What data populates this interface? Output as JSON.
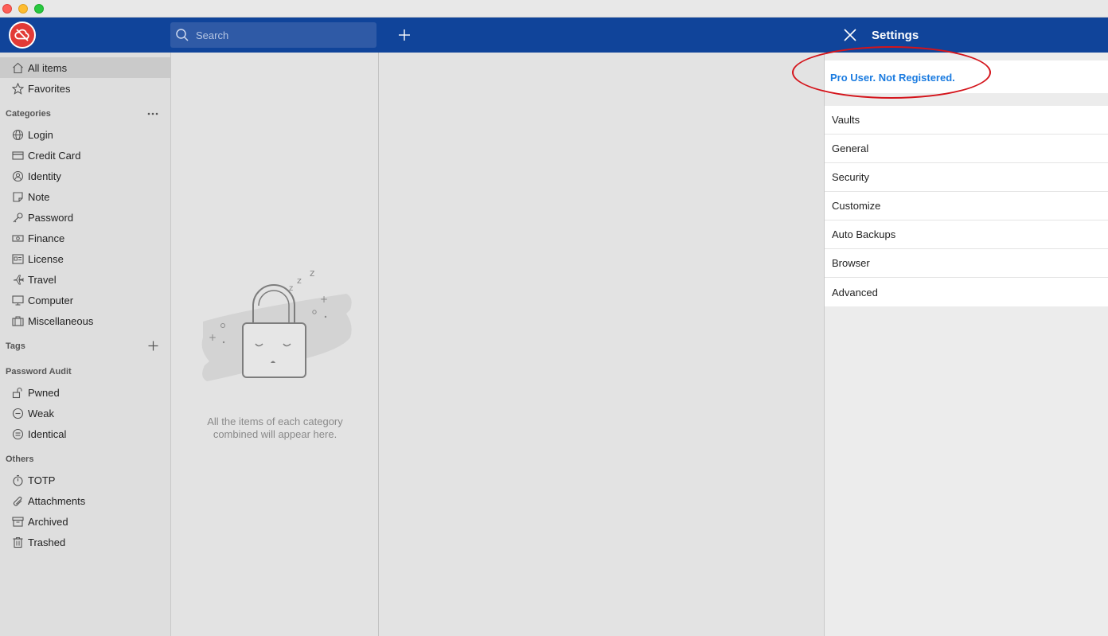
{
  "header": {
    "search_placeholder": "Search"
  },
  "sidebar": {
    "top_items": [
      {
        "label": "All items",
        "icon": "home-icon"
      },
      {
        "label": "Favorites",
        "icon": "star-icon"
      }
    ],
    "categories_title": "Categories",
    "categories": [
      {
        "label": "Login",
        "icon": "globe-icon"
      },
      {
        "label": "Credit Card",
        "icon": "credit-card-icon"
      },
      {
        "label": "Identity",
        "icon": "identity-icon"
      },
      {
        "label": "Note",
        "icon": "note-icon"
      },
      {
        "label": "Password",
        "icon": "key-icon"
      },
      {
        "label": "Finance",
        "icon": "money-icon"
      },
      {
        "label": "License",
        "icon": "license-icon"
      },
      {
        "label": "Travel",
        "icon": "plane-icon"
      },
      {
        "label": "Computer",
        "icon": "monitor-icon"
      },
      {
        "label": "Miscellaneous",
        "icon": "briefcase-icon"
      }
    ],
    "tags_title": "Tags",
    "audit_title": "Password Audit",
    "audit": [
      {
        "label": "Pwned",
        "icon": "unlock-icon"
      },
      {
        "label": "Weak",
        "icon": "minus-circle-icon"
      },
      {
        "label": "Identical",
        "icon": "equal-circle-icon"
      }
    ],
    "others_title": "Others",
    "others": [
      {
        "label": "TOTP",
        "icon": "timer-icon"
      },
      {
        "label": "Attachments",
        "icon": "paperclip-icon"
      },
      {
        "label": "Archived",
        "icon": "archive-icon"
      },
      {
        "label": "Trashed",
        "icon": "trash-icon"
      }
    ]
  },
  "list": {
    "empty_line1": "All the items of each category",
    "empty_line2": "combined will appear here."
  },
  "settings": {
    "title": "Settings",
    "pro_status": "Pro User. Not Registered.",
    "items": [
      "Vaults",
      "General",
      "Security",
      "Customize",
      "Auto Backups",
      "Browser",
      "Advanced"
    ]
  },
  "colors": {
    "header_blue": "#10449a",
    "link_blue": "#1a7be0",
    "annotation_red": "#d4141b",
    "logo_red": "#e23a36"
  }
}
